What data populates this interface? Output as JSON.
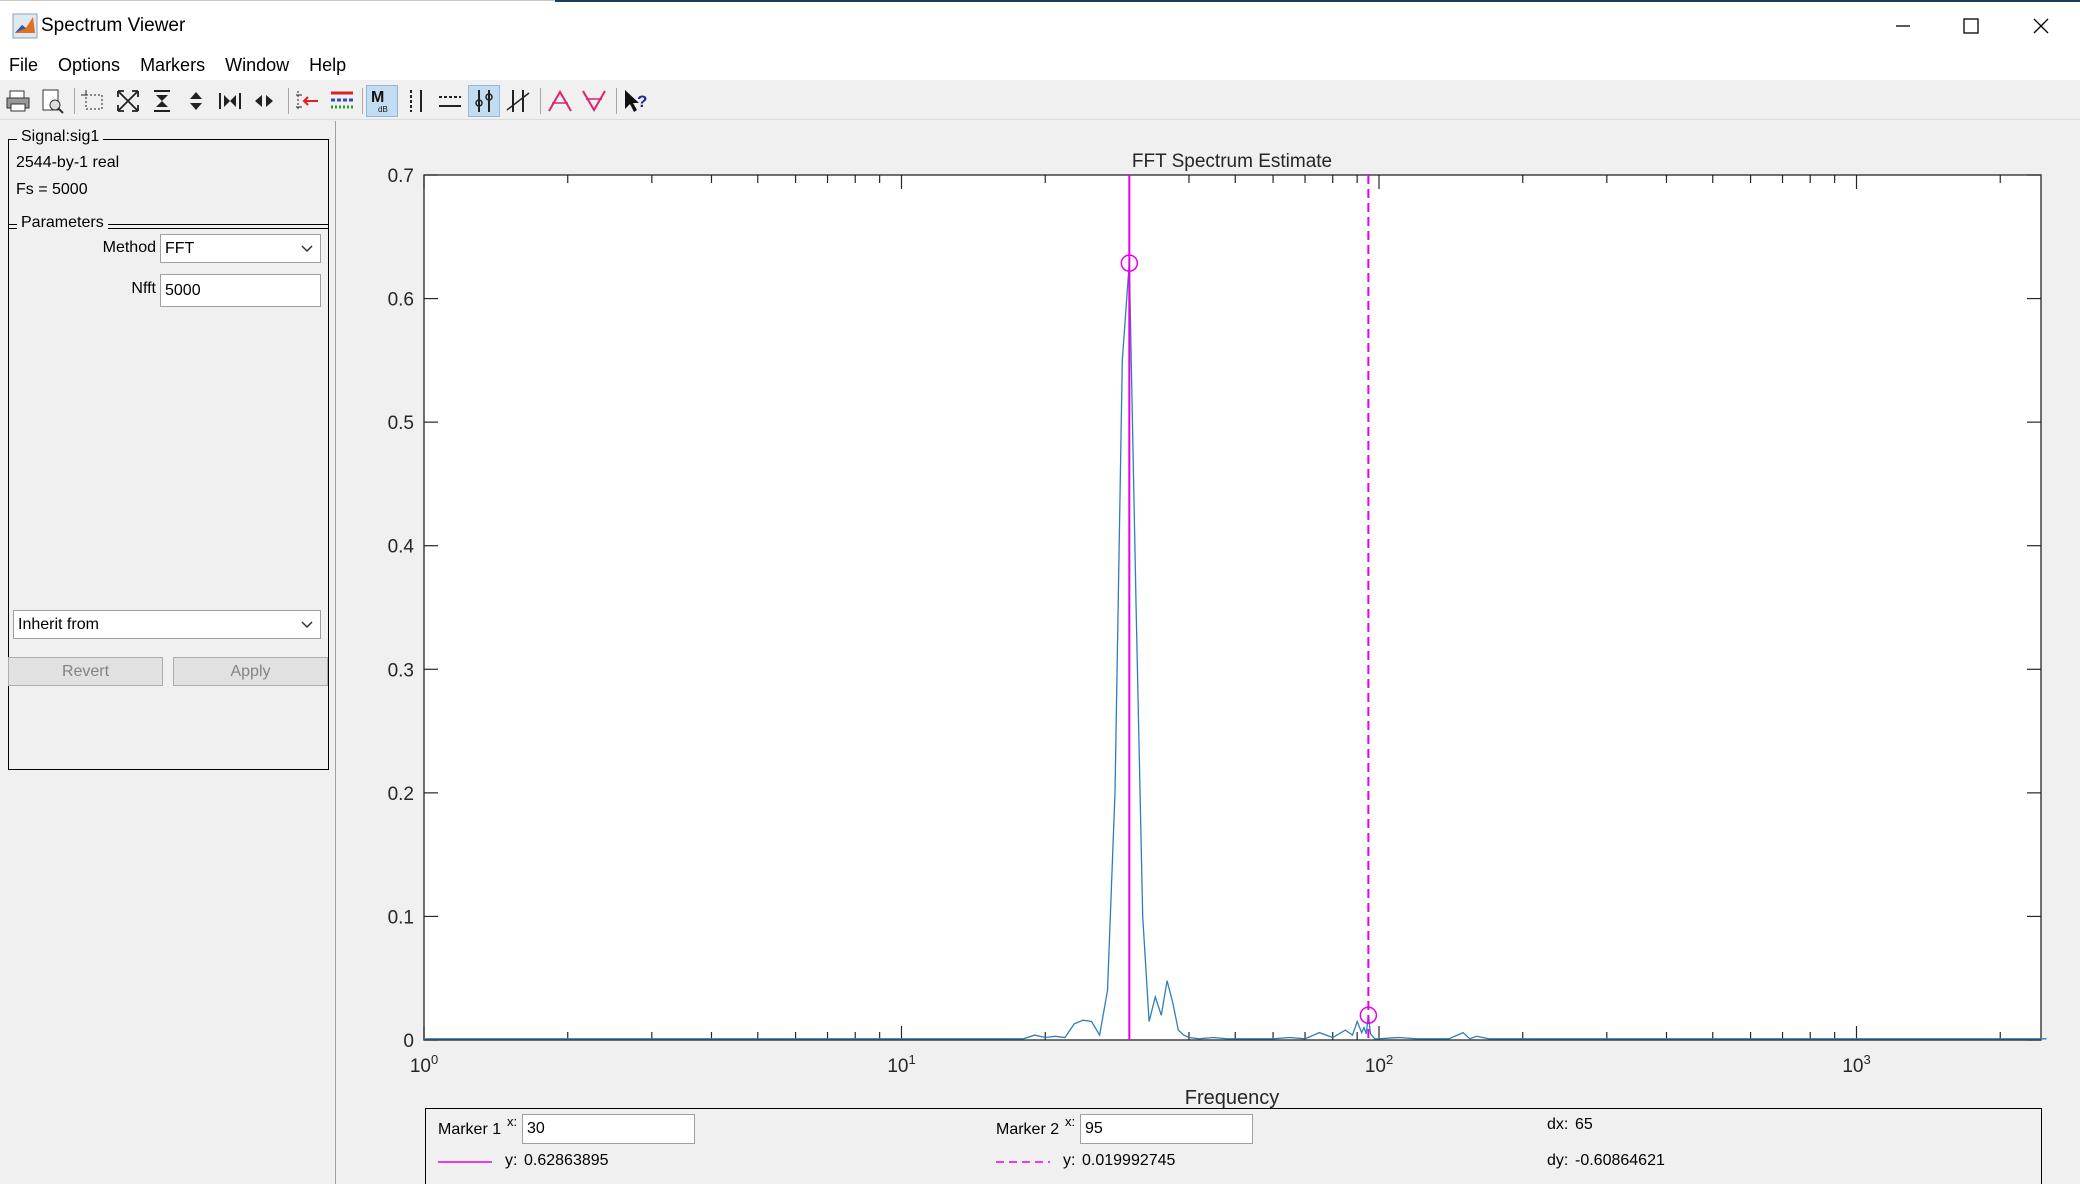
{
  "window": {
    "title": "Spectrum Viewer",
    "controls": [
      "minimize-icon",
      "maximize-icon",
      "close-icon"
    ]
  },
  "menu": [
    "File",
    "Options",
    "Markers",
    "Window",
    "Help"
  ],
  "toolbar": {
    "buttons": [
      {
        "name": "print-icon",
        "active": false
      },
      {
        "name": "print-preview-icon",
        "active": false
      },
      {
        "name": "select-region-icon",
        "active": false
      },
      {
        "name": "zoom-full-icon",
        "active": false
      },
      {
        "name": "zoom-in-y-icon",
        "active": false
      },
      {
        "name": "zoom-out-y-icon",
        "active": false
      },
      {
        "name": "zoom-in-x-icon",
        "active": false
      },
      {
        "name": "zoom-out-x-icon",
        "active": false
      },
      {
        "name": "set-marker-icon",
        "active": false
      },
      {
        "name": "line-properties-icon",
        "active": false
      },
      {
        "name": "markers-toggle-icon",
        "active": true
      },
      {
        "name": "vertical-markers-icon",
        "active": false
      },
      {
        "name": "horizontal-markers-icon",
        "active": false
      },
      {
        "name": "track-markers-icon",
        "active": true
      },
      {
        "name": "slope-markers-icon",
        "active": false
      },
      {
        "name": "peaks-icon",
        "active": false
      },
      {
        "name": "valleys-icon",
        "active": false
      },
      {
        "name": "whats-this-icon",
        "active": false
      }
    ]
  },
  "signal": {
    "group_title": "Signal:sig1",
    "size_text": "2544-by-1 real",
    "fs_text": "Fs = 5000"
  },
  "parameters": {
    "group_title": "Parameters",
    "method_label": "Method",
    "method_value": "FFT",
    "nfft_label": "Nfft",
    "nfft_value": "5000",
    "inherit_value": "Inherit from"
  },
  "buttons": {
    "revert": "Revert",
    "apply": "Apply"
  },
  "chart_data": {
    "type": "line",
    "title": "FFT Spectrum Estimate",
    "xlabel": "Frequency",
    "ylabel": "",
    "xscale": "log",
    "xlim": [
      1,
      2500
    ],
    "ylim": [
      0,
      0.7
    ],
    "yticks": [
      "0",
      "0.1",
      "0.2",
      "0.3",
      "0.4",
      "0.5",
      "0.6",
      "0.7"
    ],
    "xticks": [
      {
        "base": "10",
        "exp": "0"
      },
      {
        "base": "10",
        "exp": "1"
      },
      {
        "base": "10",
        "exp": "2"
      },
      {
        "base": "10",
        "exp": "3"
      }
    ],
    "grid": false,
    "line_color": "#2e7fb8",
    "marker_color": "#e600e6",
    "series": [
      {
        "x": [
          1,
          2,
          3,
          4,
          5,
          6,
          7,
          8,
          9,
          10,
          11,
          12,
          13,
          14,
          15,
          16,
          17,
          18,
          19,
          20,
          21,
          22,
          23,
          24,
          25,
          26,
          27,
          28,
          29,
          30,
          31,
          32,
          33,
          34,
          35,
          36,
          37,
          38,
          39,
          40,
          42,
          45,
          48,
          50,
          55,
          60,
          65,
          70,
          75,
          80,
          85,
          88,
          90,
          92,
          93,
          94,
          95,
          96,
          97,
          98,
          100,
          110,
          120,
          130,
          140,
          150,
          155,
          160,
          170,
          200,
          220,
          300,
          500,
          1000,
          2500
        ],
        "y": [
          0.001,
          0.001,
          0.001,
          0.001,
          0.001,
          0.001,
          0.001,
          0.001,
          0.001,
          0.001,
          0.001,
          0.001,
          0.001,
          0.001,
          0.001,
          0.001,
          0.001,
          0.001,
          0.004,
          0.002,
          0.003,
          0.002,
          0.013,
          0.016,
          0.015,
          0.004,
          0.04,
          0.2,
          0.55,
          0.629,
          0.35,
          0.1,
          0.015,
          0.035,
          0.02,
          0.048,
          0.03,
          0.008,
          0.004,
          0.002,
          0.001,
          0.002,
          0.001,
          0.001,
          0.001,
          0.001,
          0.002,
          0.001,
          0.006,
          0.002,
          0.008,
          0.004,
          0.015,
          0.006,
          0.01,
          0.005,
          0.02,
          0.005,
          0.003,
          0.001,
          0.001,
          0.002,
          0.001,
          0.001,
          0.001,
          0.006,
          0.001,
          0.003,
          0.001,
          0.001,
          0.001,
          0.001,
          0.001,
          0.001,
          0.001
        ]
      }
    ]
  },
  "markers": {
    "m1_label": "Marker 1",
    "m1_x": "30",
    "m1_y": "0.62863895",
    "m1_y_value": 0.62863895,
    "m2_label": "Marker 2",
    "m2_x": "95",
    "m2_y": "0.019992745",
    "m2_y_value": 0.019992745,
    "x_label": "x:",
    "y_label": "y:",
    "dx_label": "dx:",
    "dx_value": "65",
    "dy_label": "dy:",
    "dy_value": "-0.60864621"
  }
}
